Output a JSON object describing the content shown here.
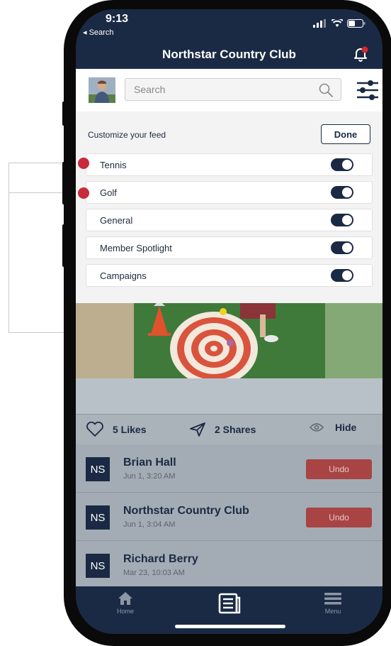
{
  "status_bar": {
    "time": "9:13",
    "back_label": "◂ Search"
  },
  "nav": {
    "title": "Northstar Country Club"
  },
  "search": {
    "placeholder": "Search"
  },
  "feed_panel": {
    "title": "Customize your feed",
    "done_label": "Done",
    "items": [
      {
        "label": "Tennis",
        "enabled": true
      },
      {
        "label": "Golf",
        "enabled": true
      },
      {
        "label": "General",
        "enabled": true
      },
      {
        "label": "Member Spotlight",
        "enabled": true
      },
      {
        "label": "Campaigns",
        "enabled": true
      }
    ]
  },
  "post_actions": {
    "likes": "5 Likes",
    "shares": "2 Shares",
    "hide": "Hide"
  },
  "notifications": [
    {
      "initials": "NS",
      "name": "Brian Hall",
      "time": "Jun 1, 3:20 AM",
      "undo_label": "Undo"
    },
    {
      "initials": "NS",
      "name": "Northstar Country Club",
      "time": "Jun 1, 3:04 AM",
      "undo_label": "Undo"
    },
    {
      "initials": "NS",
      "name": "Richard Berry",
      "time": "Mar 23, 10:03 AM"
    }
  ],
  "tab_bar": {
    "home_label": "Home",
    "menu_label": "Menu"
  },
  "colors": {
    "navy": "#1a2a44",
    "accent_red": "#c92a3a",
    "undo_red": "#a84444"
  },
  "icons": [
    "bell-icon",
    "search-icon",
    "filter-sliders-icon",
    "heart-icon",
    "send-icon",
    "eye-icon",
    "home-icon",
    "news-icon",
    "menu-icon"
  ]
}
